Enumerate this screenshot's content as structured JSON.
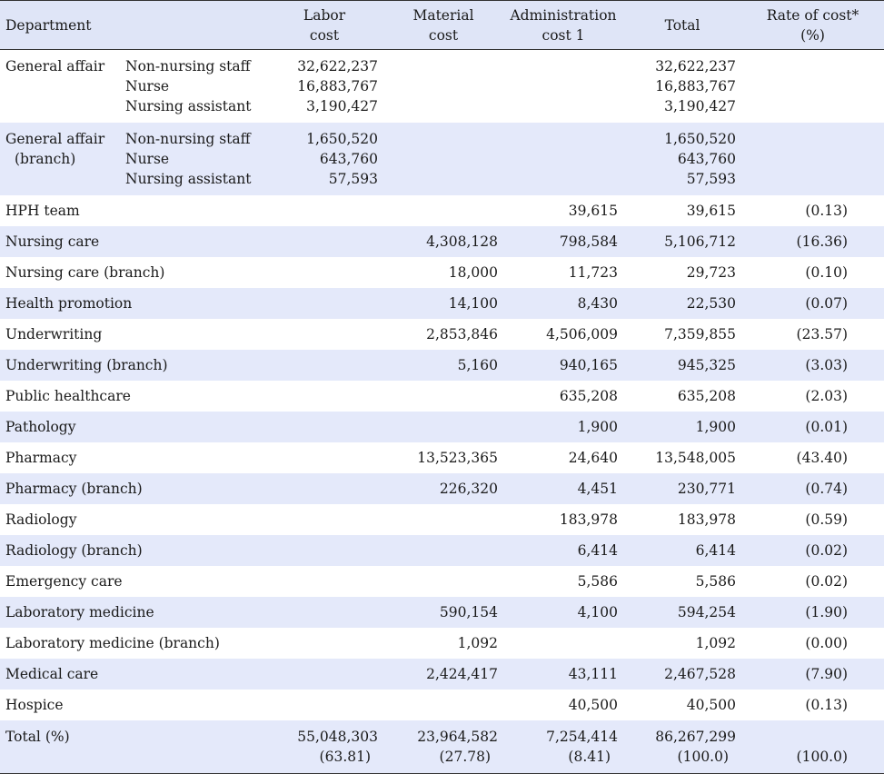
{
  "headers": {
    "department": "Department",
    "labor": [
      "Labor",
      "cost"
    ],
    "material": [
      "Material",
      "cost"
    ],
    "administration": [
      "Administration",
      "cost 1"
    ],
    "total": "Total",
    "rate": [
      "Rate of cost*",
      "(%)"
    ]
  },
  "groups": [
    {
      "department_lines": [
        "General affair"
      ],
      "staff": [
        "Non-nursing staff",
        "Nurse",
        "Nursing assistant"
      ],
      "labor": [
        "32,622,237",
        "16,883,767",
        "3,190,427"
      ],
      "total": [
        "32,622,237",
        "16,883,767",
        "3,190,427"
      ]
    },
    {
      "department_lines": [
        "General affair",
        "(branch)"
      ],
      "staff": [
        "Non-nursing staff",
        "Nurse",
        "Nursing assistant"
      ],
      "labor": [
        "1,650,520",
        "643,760",
        "57,593"
      ],
      "total": [
        "1,650,520",
        "643,760",
        "57,593"
      ]
    }
  ],
  "rows": [
    {
      "department": "HPH team",
      "labor": "",
      "material": "",
      "administration": "39,615",
      "total": "39,615",
      "rate": "(0.13)"
    },
    {
      "department": "Nursing care",
      "labor": "",
      "material": "4,308,128",
      "administration": "798,584",
      "total": "5,106,712",
      "rate": "(16.36)"
    },
    {
      "department": "Nursing care (branch)",
      "labor": "",
      "material": "18,000",
      "administration": "11,723",
      "total": "29,723",
      "rate": "(0.10)"
    },
    {
      "department": "Health promotion",
      "labor": "",
      "material": "14,100",
      "administration": "8,430",
      "total": "22,530",
      "rate": "(0.07)"
    },
    {
      "department": "Underwriting",
      "labor": "",
      "material": "2,853,846",
      "administration": "4,506,009",
      "total": "7,359,855",
      "rate": "(23.57)"
    },
    {
      "department": "Underwriting (branch)",
      "labor": "",
      "material": "5,160",
      "administration": "940,165",
      "total": "945,325",
      "rate": "(3.03)"
    },
    {
      "department": "Public healthcare",
      "labor": "",
      "material": "",
      "administration": "635,208",
      "total": "635,208",
      "rate": "(2.03)"
    },
    {
      "department": "Pathology",
      "labor": "",
      "material": "",
      "administration": "1,900",
      "total": "1,900",
      "rate": "(0.01)"
    },
    {
      "department": "Pharmacy",
      "labor": "",
      "material": "13,523,365",
      "administration": "24,640",
      "total": "13,548,005",
      "rate": "(43.40)"
    },
    {
      "department": "Pharmacy (branch)",
      "labor": "",
      "material": "226,320",
      "administration": "4,451",
      "total": "230,771",
      "rate": "(0.74)"
    },
    {
      "department": "Radiology",
      "labor": "",
      "material": "",
      "administration": "183,978",
      "total": "183,978",
      "rate": "(0.59)"
    },
    {
      "department": "Radiology (branch)",
      "labor": "",
      "material": "",
      "administration": "6,414",
      "total": "6,414",
      "rate": "(0.02)"
    },
    {
      "department": "Emergency care",
      "labor": "",
      "material": "",
      "administration": "5,586",
      "total": "5,586",
      "rate": "(0.02)"
    },
    {
      "department": "Laboratory medicine",
      "labor": "",
      "material": "590,154",
      "administration": "4,100",
      "total": "594,254",
      "rate": "(1.90)"
    },
    {
      "department": "Laboratory medicine (branch)",
      "labor": "",
      "material": "1,092",
      "administration": "",
      "total": "1,092",
      "rate": "(0.00)"
    },
    {
      "department": "Medical care",
      "labor": "",
      "material": "2,424,417",
      "administration": "43,111",
      "total": "2,467,528",
      "rate": "(7.90)"
    },
    {
      "department": "Hospice",
      "labor": "",
      "material": "",
      "administration": "40,500",
      "total": "40,500",
      "rate": "(0.13)"
    }
  ],
  "total_row": {
    "department": "Total (%)",
    "labor": [
      "55,048,303",
      "(63.81)"
    ],
    "material": [
      "23,964,582",
      "(27.78)"
    ],
    "administration": [
      "7,254,414",
      "(8.41)"
    ],
    "total": [
      "86,267,299",
      "(100.0)"
    ],
    "rate": "(100.0)"
  }
}
